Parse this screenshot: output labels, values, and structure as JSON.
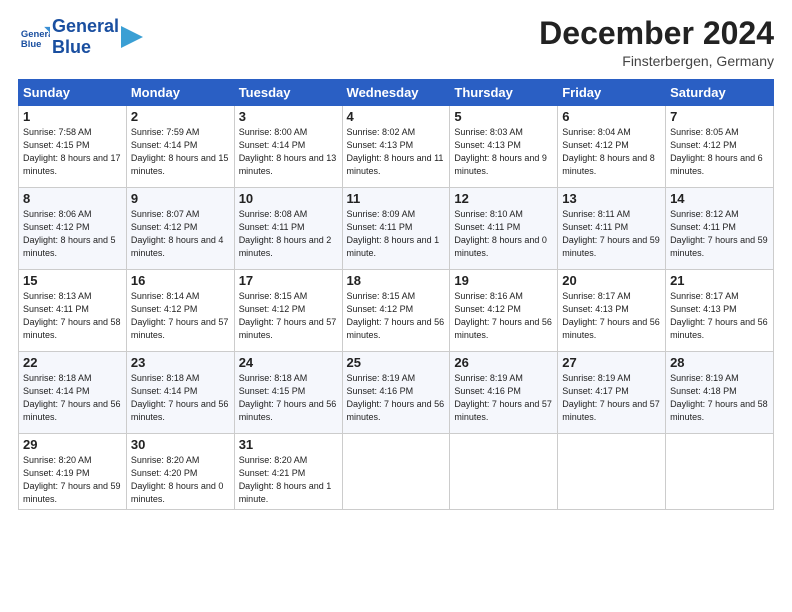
{
  "header": {
    "logo_line1": "General",
    "logo_line2": "Blue",
    "month": "December 2024",
    "location": "Finsterbergen, Germany"
  },
  "weekdays": [
    "Sunday",
    "Monday",
    "Tuesday",
    "Wednesday",
    "Thursday",
    "Friday",
    "Saturday"
  ],
  "weeks": [
    [
      {
        "day": "1",
        "info": "Sunrise: 7:58 AM\nSunset: 4:15 PM\nDaylight: 8 hours and 17 minutes."
      },
      {
        "day": "2",
        "info": "Sunrise: 7:59 AM\nSunset: 4:14 PM\nDaylight: 8 hours and 15 minutes."
      },
      {
        "day": "3",
        "info": "Sunrise: 8:00 AM\nSunset: 4:14 PM\nDaylight: 8 hours and 13 minutes."
      },
      {
        "day": "4",
        "info": "Sunrise: 8:02 AM\nSunset: 4:13 PM\nDaylight: 8 hours and 11 minutes."
      },
      {
        "day": "5",
        "info": "Sunrise: 8:03 AM\nSunset: 4:13 PM\nDaylight: 8 hours and 9 minutes."
      },
      {
        "day": "6",
        "info": "Sunrise: 8:04 AM\nSunset: 4:12 PM\nDaylight: 8 hours and 8 minutes."
      },
      {
        "day": "7",
        "info": "Sunrise: 8:05 AM\nSunset: 4:12 PM\nDaylight: 8 hours and 6 minutes."
      }
    ],
    [
      {
        "day": "8",
        "info": "Sunrise: 8:06 AM\nSunset: 4:12 PM\nDaylight: 8 hours and 5 minutes."
      },
      {
        "day": "9",
        "info": "Sunrise: 8:07 AM\nSunset: 4:12 PM\nDaylight: 8 hours and 4 minutes."
      },
      {
        "day": "10",
        "info": "Sunrise: 8:08 AM\nSunset: 4:11 PM\nDaylight: 8 hours and 2 minutes."
      },
      {
        "day": "11",
        "info": "Sunrise: 8:09 AM\nSunset: 4:11 PM\nDaylight: 8 hours and 1 minute."
      },
      {
        "day": "12",
        "info": "Sunrise: 8:10 AM\nSunset: 4:11 PM\nDaylight: 8 hours and 0 minutes."
      },
      {
        "day": "13",
        "info": "Sunrise: 8:11 AM\nSunset: 4:11 PM\nDaylight: 7 hours and 59 minutes."
      },
      {
        "day": "14",
        "info": "Sunrise: 8:12 AM\nSunset: 4:11 PM\nDaylight: 7 hours and 59 minutes."
      }
    ],
    [
      {
        "day": "15",
        "info": "Sunrise: 8:13 AM\nSunset: 4:11 PM\nDaylight: 7 hours and 58 minutes."
      },
      {
        "day": "16",
        "info": "Sunrise: 8:14 AM\nSunset: 4:12 PM\nDaylight: 7 hours and 57 minutes."
      },
      {
        "day": "17",
        "info": "Sunrise: 8:15 AM\nSunset: 4:12 PM\nDaylight: 7 hours and 57 minutes."
      },
      {
        "day": "18",
        "info": "Sunrise: 8:15 AM\nSunset: 4:12 PM\nDaylight: 7 hours and 56 minutes."
      },
      {
        "day": "19",
        "info": "Sunrise: 8:16 AM\nSunset: 4:12 PM\nDaylight: 7 hours and 56 minutes."
      },
      {
        "day": "20",
        "info": "Sunrise: 8:17 AM\nSunset: 4:13 PM\nDaylight: 7 hours and 56 minutes."
      },
      {
        "day": "21",
        "info": "Sunrise: 8:17 AM\nSunset: 4:13 PM\nDaylight: 7 hours and 56 minutes."
      }
    ],
    [
      {
        "day": "22",
        "info": "Sunrise: 8:18 AM\nSunset: 4:14 PM\nDaylight: 7 hours and 56 minutes."
      },
      {
        "day": "23",
        "info": "Sunrise: 8:18 AM\nSunset: 4:14 PM\nDaylight: 7 hours and 56 minutes."
      },
      {
        "day": "24",
        "info": "Sunrise: 8:18 AM\nSunset: 4:15 PM\nDaylight: 7 hours and 56 minutes."
      },
      {
        "day": "25",
        "info": "Sunrise: 8:19 AM\nSunset: 4:16 PM\nDaylight: 7 hours and 56 minutes."
      },
      {
        "day": "26",
        "info": "Sunrise: 8:19 AM\nSunset: 4:16 PM\nDaylight: 7 hours and 57 minutes."
      },
      {
        "day": "27",
        "info": "Sunrise: 8:19 AM\nSunset: 4:17 PM\nDaylight: 7 hours and 57 minutes."
      },
      {
        "day": "28",
        "info": "Sunrise: 8:19 AM\nSunset: 4:18 PM\nDaylight: 7 hours and 58 minutes."
      }
    ],
    [
      {
        "day": "29",
        "info": "Sunrise: 8:20 AM\nSunset: 4:19 PM\nDaylight: 7 hours and 59 minutes."
      },
      {
        "day": "30",
        "info": "Sunrise: 8:20 AM\nSunset: 4:20 PM\nDaylight: 8 hours and 0 minutes."
      },
      {
        "day": "31",
        "info": "Sunrise: 8:20 AM\nSunset: 4:21 PM\nDaylight: 8 hours and 1 minute."
      },
      null,
      null,
      null,
      null
    ]
  ]
}
